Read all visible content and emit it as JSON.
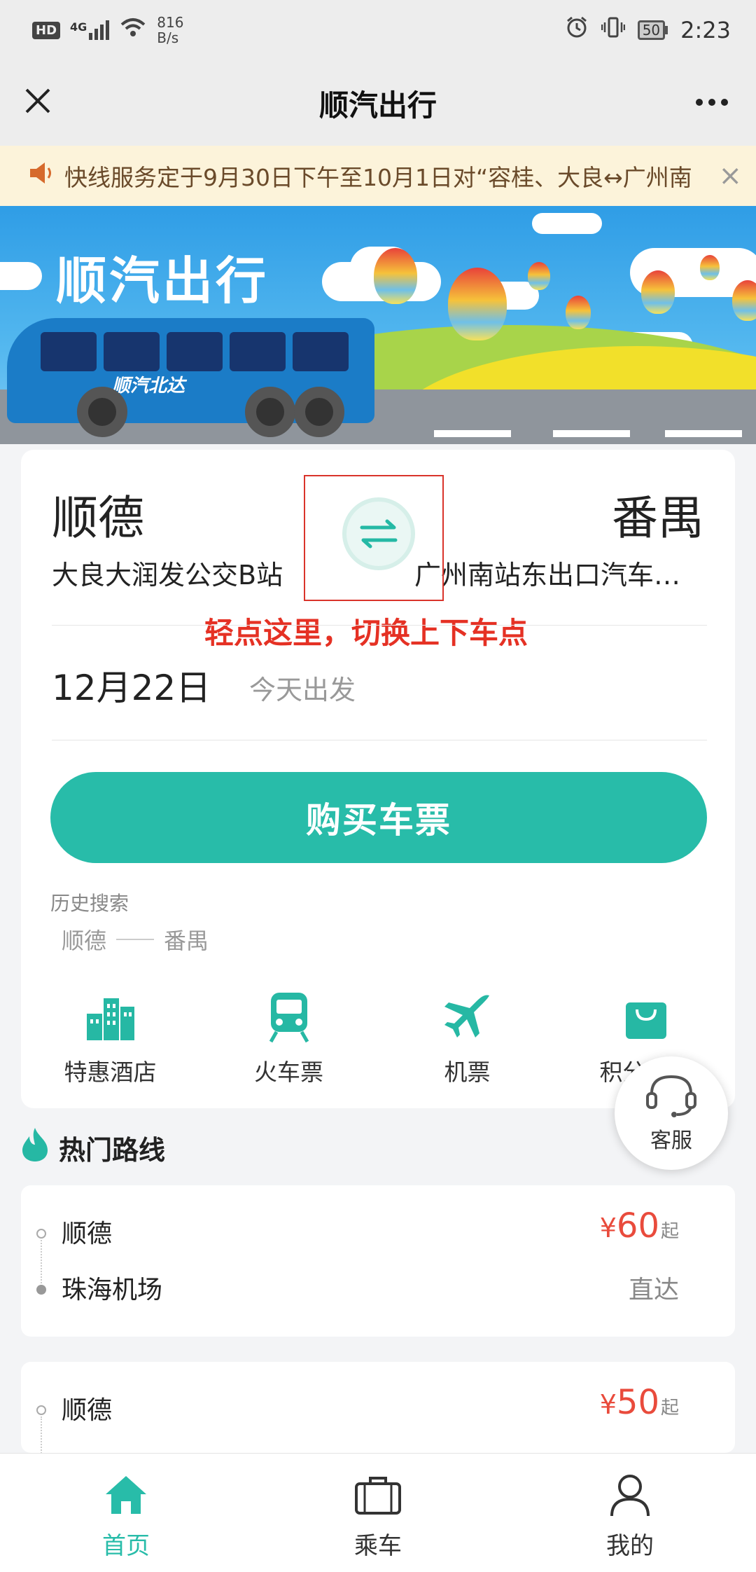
{
  "status_bar": {
    "badge": "HD",
    "network": "4G",
    "speed_value": "816",
    "speed_unit": "B/s",
    "battery": "50",
    "time": "2:23"
  },
  "title_bar": {
    "title": "顺汽出行",
    "close_icon": "close-icon",
    "more_icon": "more-icon"
  },
  "notice": {
    "text": "快线服务定于9月30日下午至10月1日对“容桂、大良↔广州南",
    "close_glyph": "×"
  },
  "banner": {
    "brand": "顺汽出行",
    "bus_label": "顺汽北达"
  },
  "booking": {
    "from_city": "顺德",
    "to_city": "番禺",
    "from_station": "大良大润发公交B站",
    "to_station": "广州南站东出口汽车…",
    "swap_hint": "轻点这里，切换上下车点",
    "date": "12月22日",
    "date_hint": "今天出发",
    "buy_label": "购买车票",
    "history_label": "历史搜索",
    "history": [
      {
        "from": "顺德",
        "to": "番禺"
      }
    ]
  },
  "quick_links": [
    {
      "label": "特惠酒店",
      "icon": "hotel-icon"
    },
    {
      "label": "火车票",
      "icon": "train-icon"
    },
    {
      "label": "机票",
      "icon": "plane-icon"
    },
    {
      "label": "积分商城",
      "icon": "shopping-bag-icon"
    }
  ],
  "customer_service": {
    "label": "客服",
    "icon": "headset-icon"
  },
  "hot_routes": {
    "title": "热门路线",
    "items": [
      {
        "from": "顺德",
        "to": "珠海机场",
        "currency": "¥",
        "price": "60",
        "suffix": "起",
        "type": "直达"
      },
      {
        "from": "顺德",
        "to": "",
        "currency": "¥",
        "price": "50",
        "suffix": "起",
        "type": ""
      }
    ]
  },
  "bottom_nav": [
    {
      "label": "首页",
      "icon": "home-icon",
      "active": true
    },
    {
      "label": "乘车",
      "icon": "briefcase-icon",
      "active": false
    },
    {
      "label": "我的",
      "icon": "user-icon",
      "active": false
    }
  ],
  "colors": {
    "accent": "#28bca9",
    "price": "#e94b3c",
    "hint_red": "#e53124",
    "notice_bg": "#fcf3da"
  }
}
